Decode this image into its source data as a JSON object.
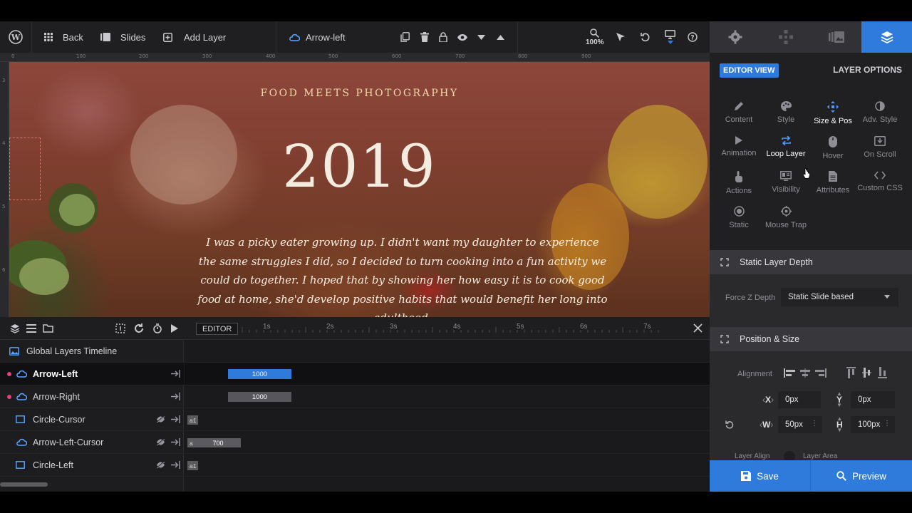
{
  "toolbar": {
    "back_label": "Back",
    "slides_label": "Slides",
    "add_layer_label": "Add Layer",
    "layer_name": "Arrow-left",
    "zoom": "100%"
  },
  "ruler": {
    "top_ticks": [
      "0",
      "100",
      "200",
      "300",
      "400",
      "500",
      "600",
      "700",
      "800",
      "900"
    ],
    "left_ticks": [
      "3",
      "4",
      "5",
      "6"
    ]
  },
  "slide": {
    "subtitle": "FOOD MEETS PHOTOGRAPHY",
    "year": "2019",
    "quote": "I was a picky eater growing up. I didn't want my daughter to experience the same struggles I did, so I decided to turn cooking into a fun activity we could do together. I hoped that by showing her how easy it is to cook good food at home, she'd develop positive habits that would benefit her long into adulthood."
  },
  "timeline": {
    "editor_label": "EDITOR",
    "time_marks": [
      "1s",
      "2s",
      "3s",
      "4s",
      "5s",
      "6s",
      "7s"
    ],
    "global_label": "Global Layers Timeline",
    "layers": [
      {
        "name": "Arrow-Left",
        "bar_label": "1000",
        "bar_color": "#2e7bdc",
        "dot": true,
        "icon": "cloud-icon",
        "selected": true
      },
      {
        "name": "Arrow-Right",
        "bar_label": "1000",
        "bar_color": "#56565b",
        "dot": true,
        "icon": "cloud-icon",
        "selected": false
      },
      {
        "name": "Circle-Cursor",
        "small_label": "a",
        "small_label2": "1",
        "dot": false,
        "icon": "square-icon",
        "selected": false
      },
      {
        "name": "Arrow-Left-Cursor",
        "small_label": "a",
        "bar_label": "700",
        "dot": false,
        "icon": "cloud-icon",
        "selected": false
      },
      {
        "name": "Circle-Left",
        "small_label": "a",
        "small_label2": "1",
        "dot": false,
        "icon": "square-icon",
        "selected": false
      }
    ]
  },
  "panel": {
    "editor_view": "EDITOR VIEW",
    "layer_options": "LAYER OPTIONS",
    "options": [
      {
        "label": "Content",
        "icon": "pencil-icon",
        "active": false
      },
      {
        "label": "Style",
        "icon": "palette-icon",
        "active": false
      },
      {
        "label": "Size & Pos",
        "icon": "move-icon",
        "active": true
      },
      {
        "label": "Adv. Style",
        "icon": "contrast-icon",
        "active": false
      },
      {
        "label": "Animation",
        "icon": "play-icon",
        "active": false
      },
      {
        "label": "Loop Layer",
        "icon": "loop-icon",
        "active": true
      },
      {
        "label": "Hover",
        "icon": "mouse-icon",
        "active": false
      },
      {
        "label": "On Scroll",
        "icon": "download-icon",
        "active": false
      },
      {
        "label": "Actions",
        "icon": "touch-icon",
        "active": false
      },
      {
        "label": "Visibility",
        "icon": "visibility-icon",
        "active": false
      },
      {
        "label": "Attributes",
        "icon": "file-icon",
        "active": false
      },
      {
        "label": "Custom CSS",
        "icon": "code-icon",
        "active": false
      },
      {
        "label": "Static",
        "icon": "target-icon",
        "active": false
      },
      {
        "label": "Mouse Trap",
        "icon": "crosshair-icon",
        "active": false
      }
    ],
    "static_depth": {
      "title": "Static Layer Depth",
      "force_label": "Force Z Depth",
      "force_value": "Static Slide based"
    },
    "position_size": {
      "title": "Position & Size",
      "alignment_label": "Alignment",
      "x_label": "X",
      "x_value": "0px",
      "y_label": "Y",
      "y_value": "0px",
      "w_label": "W",
      "w_value": "50px",
      "h_label": "H",
      "h_value": "100px",
      "layer_align_label": "Layer Align",
      "layer_area_label": "Layer Area"
    },
    "save_label": "Save",
    "preview_label": "Preview"
  },
  "colors": {
    "accent": "#2e7bdc",
    "pink_dot": "#e0447a"
  }
}
